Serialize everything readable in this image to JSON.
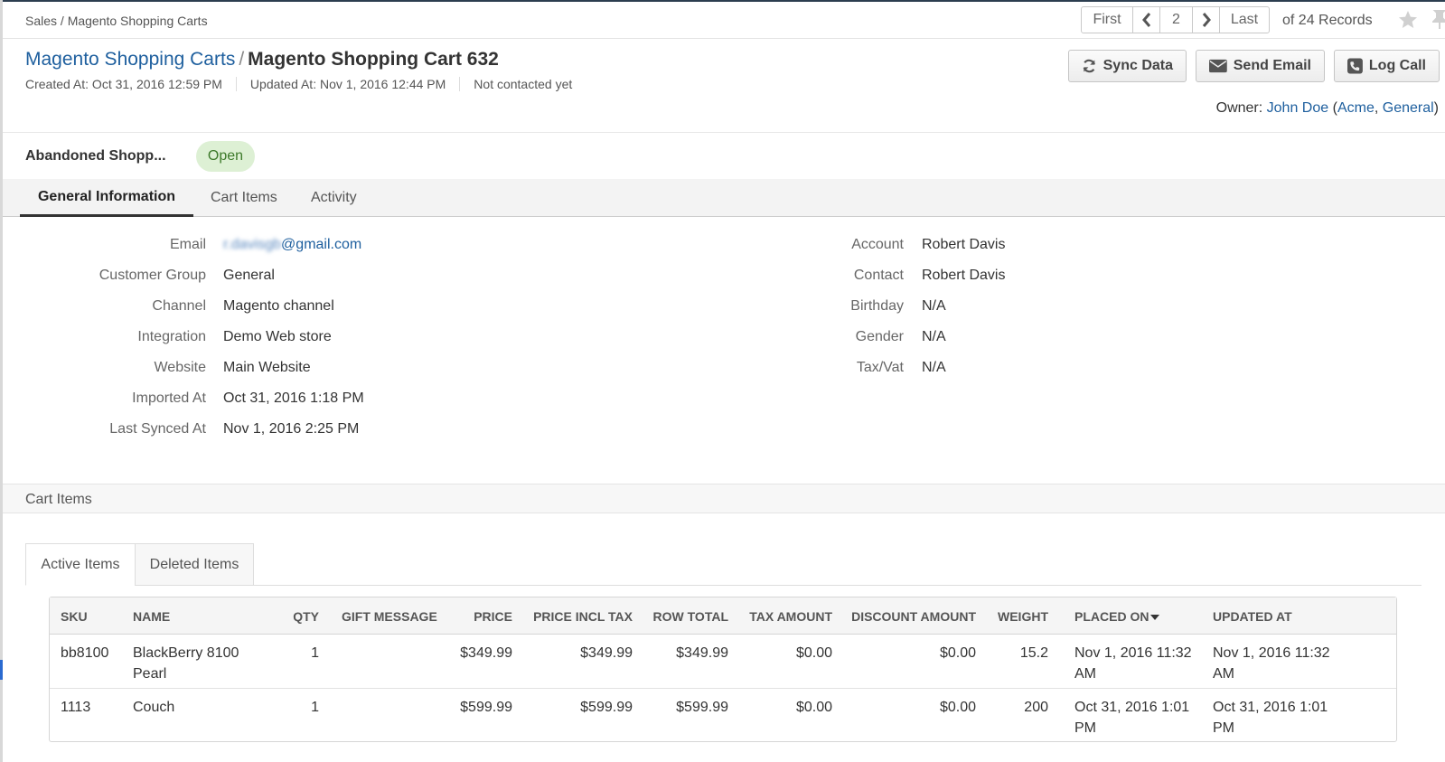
{
  "breadcrumb": "Sales / Magento Shopping Carts",
  "pager": {
    "first": "First",
    "page": "2",
    "last": "Last",
    "records": "of 24 Records"
  },
  "title": {
    "parent": "Magento Shopping Carts",
    "separator": "/",
    "current": "Magento Shopping Cart 632"
  },
  "meta": {
    "created": "Created At: Oct 31, 2016 12:59 PM",
    "updated": "Updated At: Nov 1, 2016 12:44 PM",
    "contacted": "Not contacted yet"
  },
  "actions": {
    "sync": "Sync Data",
    "email": "Send Email",
    "call": "Log Call"
  },
  "owner": {
    "label": "Owner:",
    "name": "John Doe",
    "open_paren": "(",
    "bu1": "Acme",
    "comma": ",",
    "bu2": "General",
    "close_paren": ")"
  },
  "status": {
    "name": "Abandoned Shopp...",
    "badge": "Open"
  },
  "tabs": [
    {
      "label": "General Information"
    },
    {
      "label": "Cart Items"
    },
    {
      "label": "Activity"
    }
  ],
  "general": {
    "left": [
      {
        "label": "Email",
        "value_blur": "r.davisgb",
        "value": "@gmail.com"
      },
      {
        "label": "Customer Group",
        "value": "General"
      },
      {
        "label": "Channel",
        "value": "Magento channel"
      },
      {
        "label": "Integration",
        "value": "Demo Web store"
      },
      {
        "label": "Website",
        "value": "Main Website"
      },
      {
        "label": "Imported At",
        "value": "Oct 31, 2016 1:18 PM"
      },
      {
        "label": "Last Synced At",
        "value": "Nov 1, 2016 2:25 PM"
      }
    ],
    "right": [
      {
        "label": "Account",
        "value": "Robert Davis"
      },
      {
        "label": "Contact",
        "value": "Robert Davis"
      },
      {
        "label": "Birthday",
        "value": "N/A"
      },
      {
        "label": "Gender",
        "value": "N/A"
      },
      {
        "label": "Tax/Vat",
        "value": "N/A"
      }
    ]
  },
  "cart_section": {
    "title": "Cart Items",
    "subtabs": {
      "active": "Active Items",
      "deleted": "Deleted Items"
    },
    "columns": {
      "sku": "SKU",
      "name": "NAME",
      "qty": "QTY",
      "gift": "GIFT MESSAGE",
      "price": "PRICE",
      "price_incl": "PRICE INCL TAX",
      "row_total": "ROW TOTAL",
      "tax": "TAX AMOUNT",
      "discount": "DISCOUNT AMOUNT",
      "weight": "WEIGHT",
      "placed": "PLACED ON",
      "updated": "UPDATED AT"
    },
    "rows": [
      {
        "sku": "bb8100",
        "name": "BlackBerry 8100 Pearl",
        "qty": "1",
        "gift": "",
        "price": "$349.99",
        "price_incl": "$349.99",
        "row_total": "$349.99",
        "tax": "$0.00",
        "discount": "$0.00",
        "weight": "15.2",
        "placed": "Nov 1, 2016 11:32 AM",
        "updated": "Nov 1, 2016 11:32 AM"
      },
      {
        "sku": "1113",
        "name": "Couch",
        "qty": "1",
        "gift": "",
        "price": "$599.99",
        "price_incl": "$599.99",
        "row_total": "$599.99",
        "tax": "$0.00",
        "discount": "$0.00",
        "weight": "200",
        "placed": "Oct 31, 2016 1:01 PM",
        "updated": "Oct 31, 2016 1:01 PM"
      }
    ]
  },
  "icons": [
    "chevron-left-icon",
    "chevron-right-icon",
    "star-icon",
    "pin-icon",
    "refresh-icon",
    "envelope-icon",
    "phone-icon",
    "sort-desc-icon"
  ],
  "colors": {
    "link": "#1e5f9e",
    "badge_bg": "#ddf0d4",
    "badge_text": "#3d7a2a"
  }
}
